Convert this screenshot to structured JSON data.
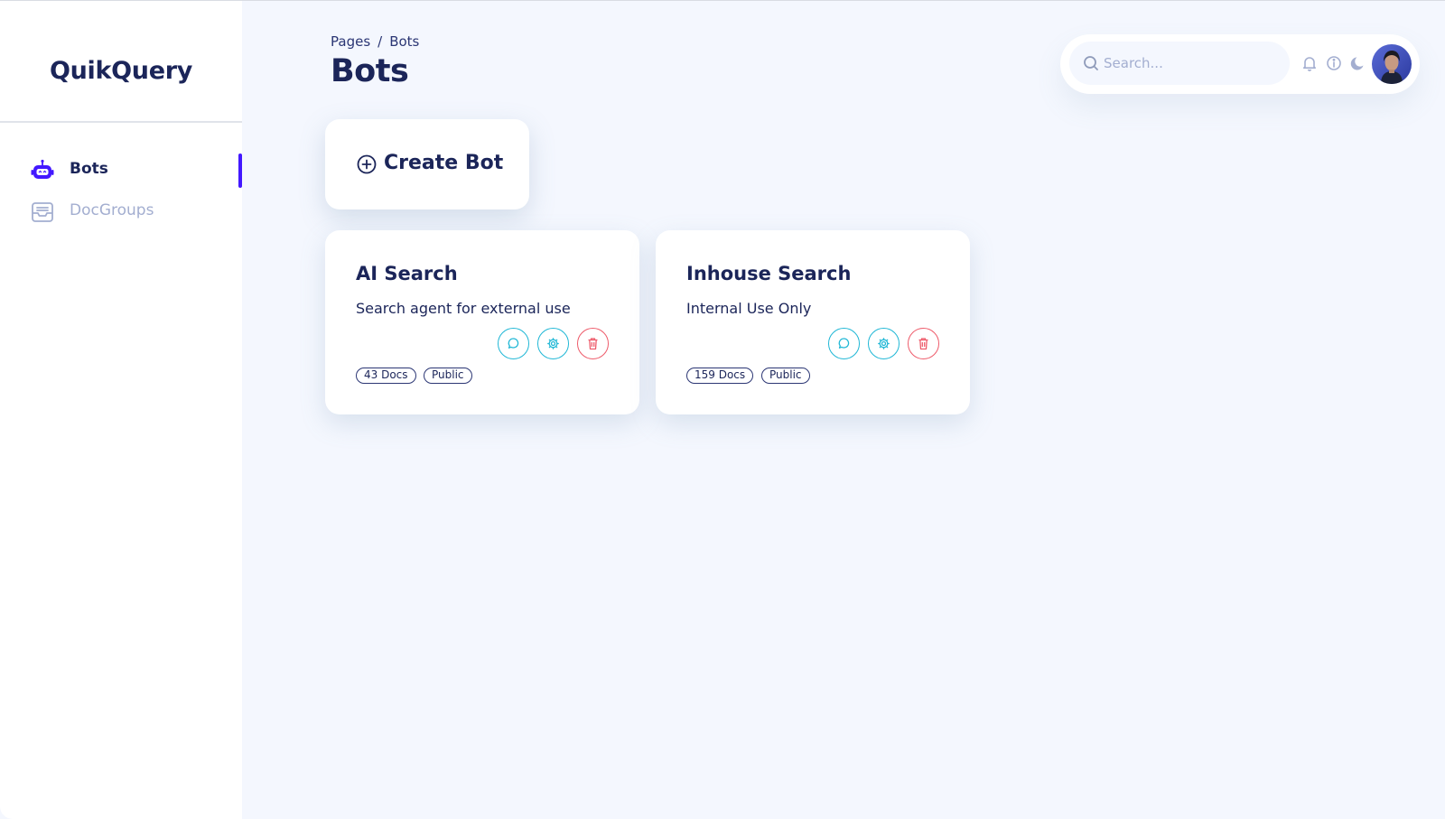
{
  "app": {
    "brand": "QuikQuery"
  },
  "sidebar": {
    "items": [
      {
        "label": "Bots",
        "icon": "robot-icon",
        "active": true
      },
      {
        "label": "DocGroups",
        "icon": "inbox-icon",
        "active": false
      }
    ]
  },
  "header": {
    "breadcrumb": {
      "root": "Pages",
      "separator": "/",
      "current": "Bots"
    },
    "title": "Bots",
    "search": {
      "placeholder": "Search...",
      "value": ""
    },
    "icons": [
      "bell-icon",
      "info-icon",
      "moon-icon"
    ]
  },
  "create": {
    "label": "Create Bot",
    "icon": "plus-circle-icon"
  },
  "bots": [
    {
      "name": "AI Search",
      "description": "Search agent for external use",
      "docs": "43 Docs",
      "visibility": "Public"
    },
    {
      "name": "Inhouse Search",
      "description": "Internal Use Only",
      "docs": "159 Docs",
      "visibility": "Public"
    }
  ],
  "colors": {
    "accent": "#4318ff",
    "text": "#1b2559",
    "muted": "#a3aed0",
    "action": "#22b8d6",
    "danger": "#ee5d6c",
    "background": "#f4f7fe"
  }
}
